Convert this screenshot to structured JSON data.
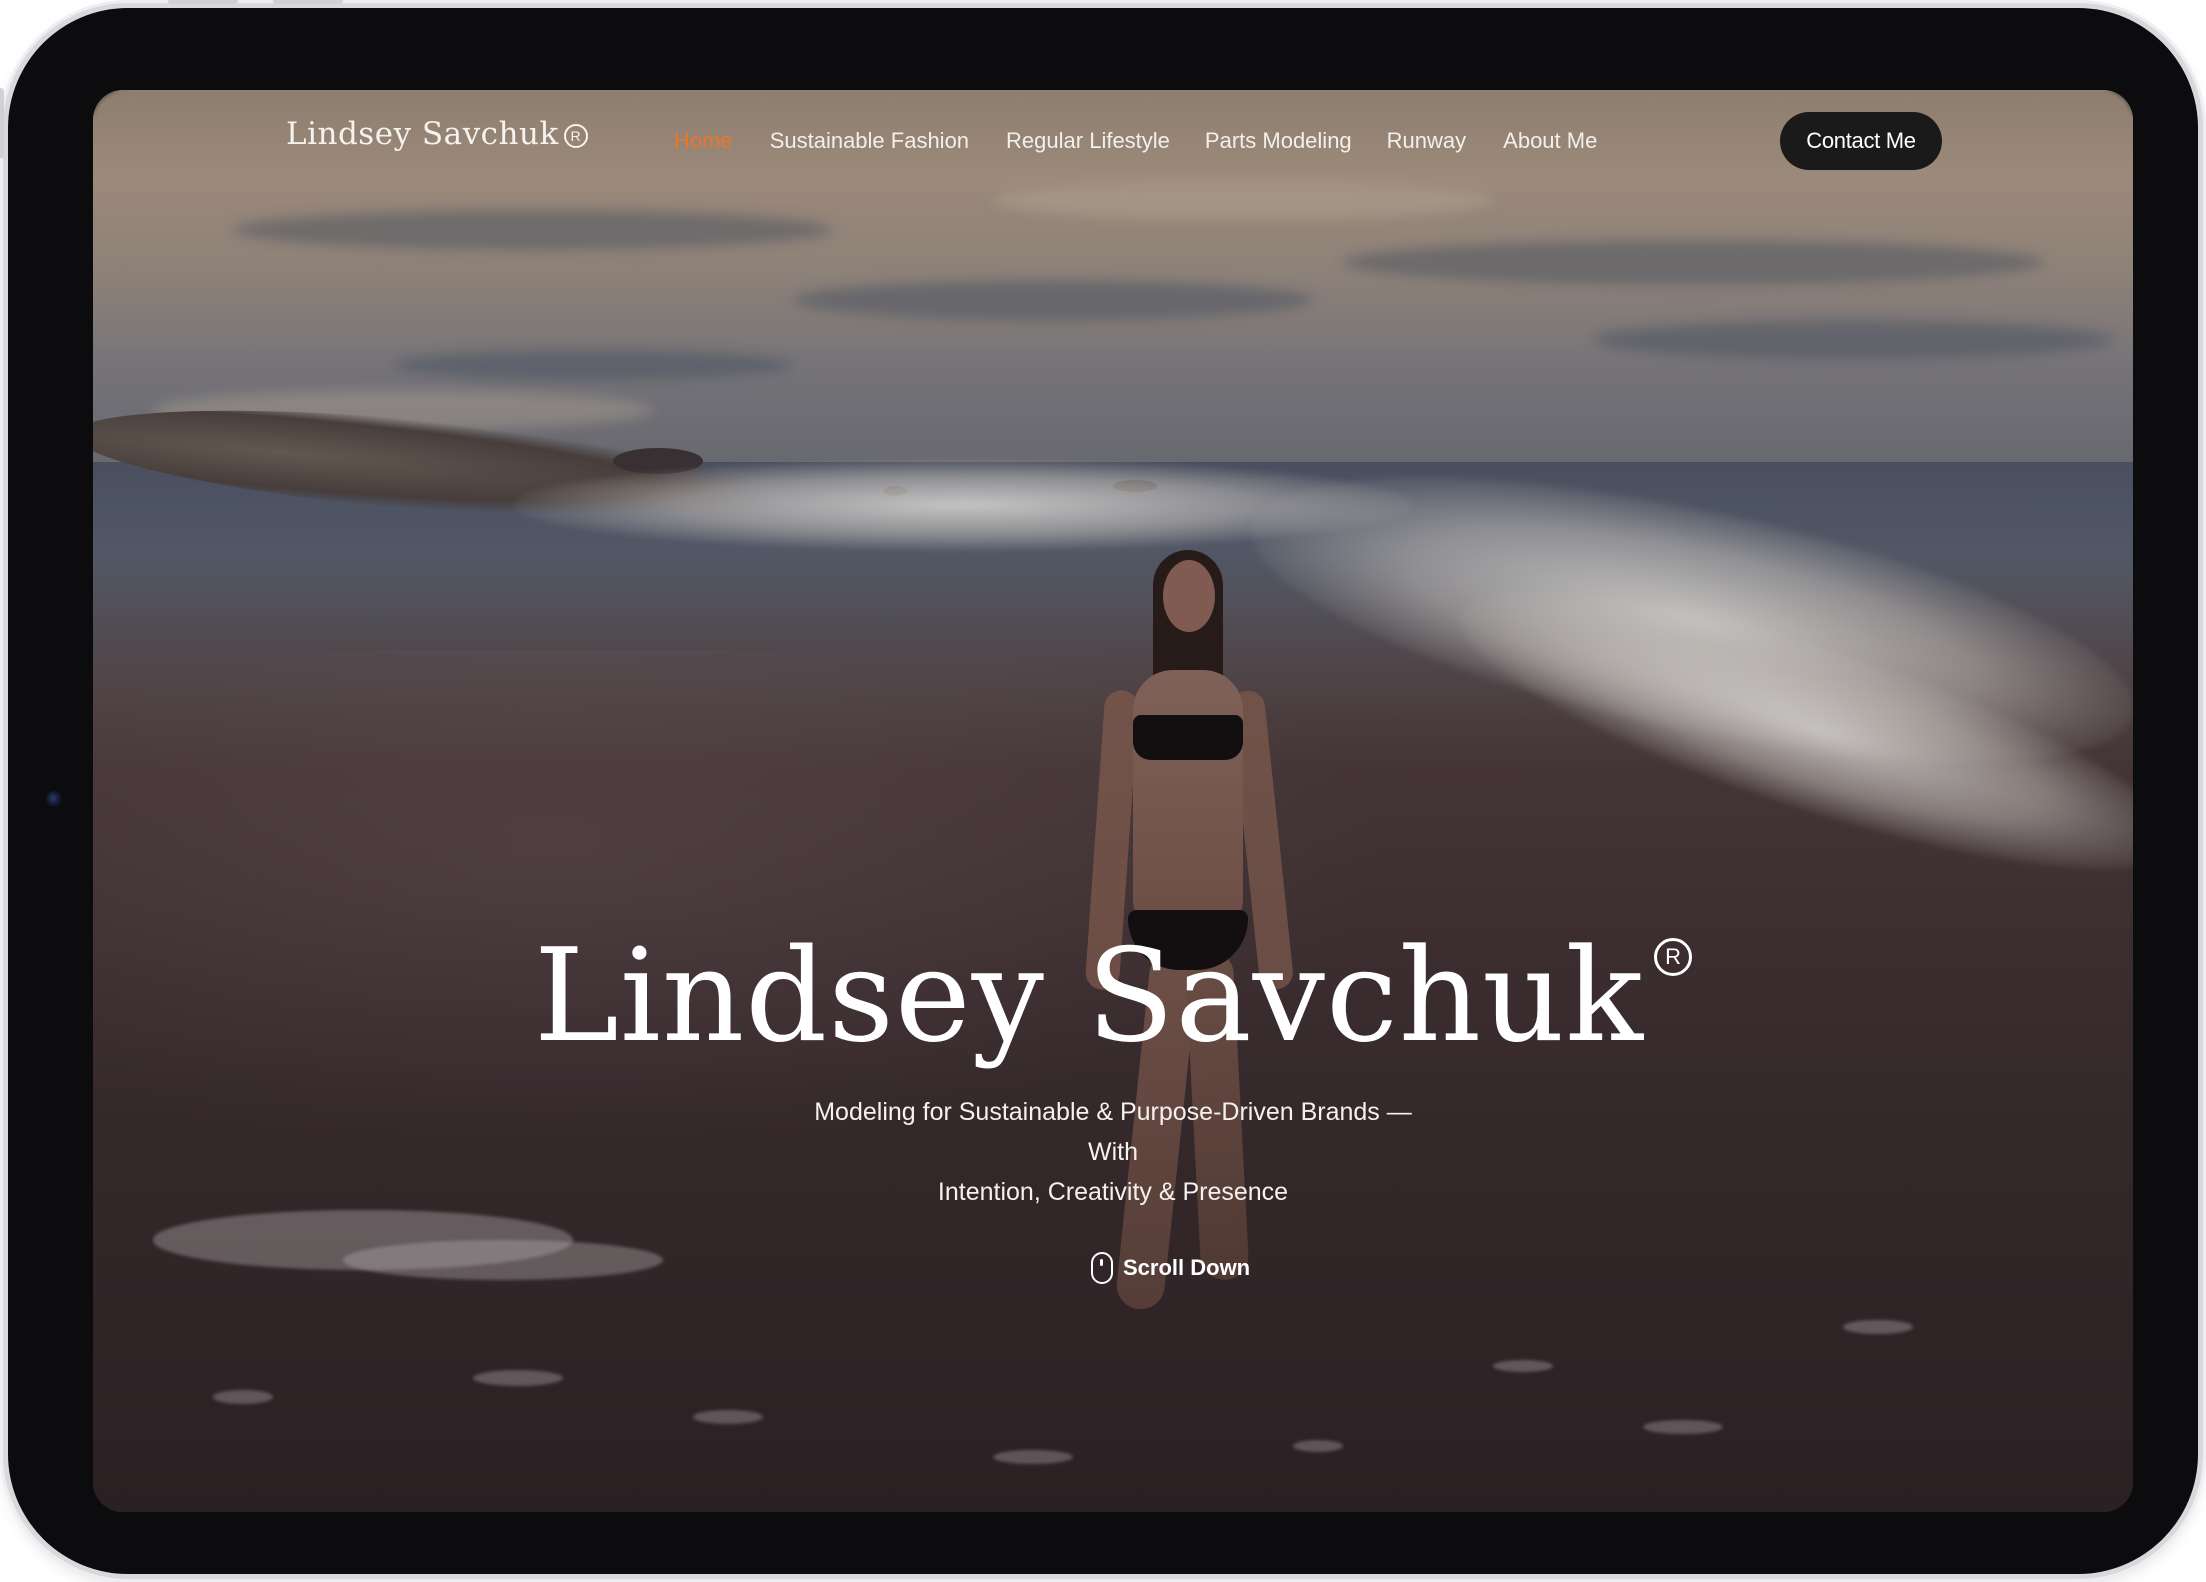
{
  "header": {
    "logo": "Lindsey Savchuk",
    "logo_mark": "R",
    "nav": [
      {
        "label": "Home",
        "active": true
      },
      {
        "label": "Sustainable Fashion",
        "active": false
      },
      {
        "label": "Regular Lifestyle",
        "active": false
      },
      {
        "label": "Parts Modeling",
        "active": false
      },
      {
        "label": "Runway",
        "active": false
      },
      {
        "label": "About Me",
        "active": false
      }
    ],
    "cta": "Contact Me"
  },
  "hero": {
    "title": "Lindsey Savchuk",
    "title_mark": "R",
    "subtitle_line1": "Modeling for Sustainable & Purpose-Driven Brands — With",
    "subtitle_line2": "Intention, Creativity & Presence",
    "scroll_label": "Scroll Down",
    "scroll_icon": "mouse-icon"
  },
  "colors": {
    "accent": "#e9762b",
    "cta_bg": "#1a1a1b",
    "text": "#ffffff"
  }
}
